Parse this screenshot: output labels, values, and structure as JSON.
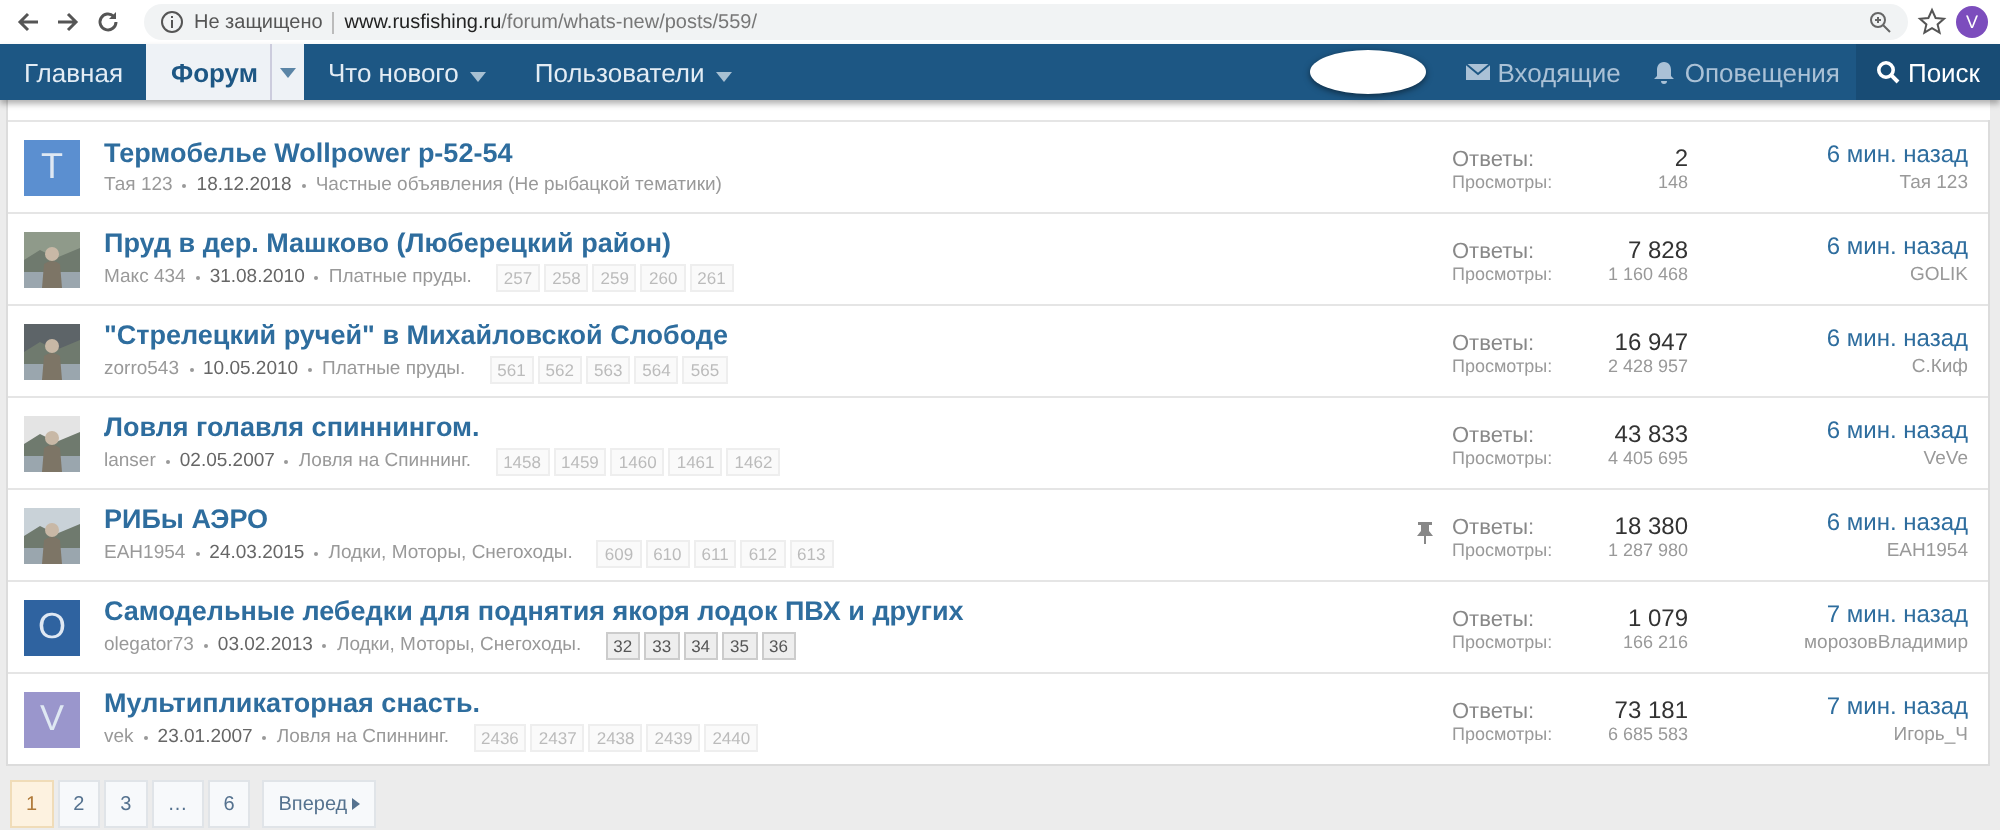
{
  "browser": {
    "security": "Не защищено",
    "url_domain": "www.rusfishing.ru",
    "url_path": "/forum/whats-new/posts/559/",
    "profile_letter": "V"
  },
  "nav": {
    "tabs": [
      {
        "label": "Главная",
        "selected": false,
        "has_menu": false
      },
      {
        "label": "Форум",
        "selected": true,
        "has_menu": true
      },
      {
        "label": "Что нового",
        "selected": false,
        "has_menu": true
      },
      {
        "label": "Пользователи",
        "selected": false,
        "has_menu": true
      }
    ],
    "right": [
      {
        "kind": "inbox",
        "label": "Входящие"
      },
      {
        "kind": "alerts",
        "label": "Оповещения"
      },
      {
        "kind": "search",
        "label": "Поиск"
      }
    ]
  },
  "threads": [
    {
      "avatar": {
        "kind": "letter",
        "letter": "T",
        "color": "#5b8fd0"
      },
      "title": "Термобелье Wollpower p-52-54",
      "author": "Тая 123",
      "date": "18.12.2018",
      "forum": "Частные объявления (Не рыбацкой тематики)",
      "pinned": false,
      "replies_label": "Ответы:",
      "replies": "2",
      "views_label": "Просмотры:",
      "views": "148",
      "last_time": "6 мин. назад",
      "last_user": "Тая 123"
    },
    {
      "title": "Пруд в дер. Машково (Люберецкий район)",
      "author": "Макс 434",
      "date": "31.08.2010",
      "forum": "Платные пруды.",
      "pages": [
        "257",
        "258",
        "259",
        "260",
        "261"
      ],
      "pages_emphasized": false,
      "pinned": false,
      "replies_label": "Ответы:",
      "replies": "7 828",
      "views_label": "Просмотры:",
      "views": "1 160 468",
      "last_time": "6 мин. назад",
      "last_user": "GOLIK"
    },
    {
      "title": "\"Стрелецкий ручей\" в Михайловской Слободе",
      "author": "zorro543",
      "date": "10.05.2010",
      "forum": "Платные пруды.",
      "pages": [
        "561",
        "562",
        "563",
        "564",
        "565"
      ],
      "pages_emphasized": false,
      "pinned": false,
      "replies_label": "Ответы:",
      "replies": "16 947",
      "views_label": "Просмотры:",
      "views": "2 428 957",
      "last_time": "6 мин. назад",
      "last_user": "С.Киф"
    },
    {
      "title": "Ловля голавля спиннингом.",
      "author": "lanser",
      "date": "02.05.2007",
      "forum": "Ловля на Спиннинг.",
      "pages": [
        "1458",
        "1459",
        "1460",
        "1461",
        "1462"
      ],
      "pages_emphasized": false,
      "pinned": false,
      "replies_label": "Ответы:",
      "replies": "43 833",
      "views_label": "Просмотры:",
      "views": "4 405 695",
      "last_time": "6 мин. назад",
      "last_user": "VeVe"
    },
    {
      "title": "РИБы АЭРО",
      "author": "EAH1954",
      "date": "24.03.2015",
      "forum": "Лодки, Моторы, Снегоходы.",
      "pages": [
        "609",
        "610",
        "611",
        "612",
        "613"
      ],
      "pages_emphasized": false,
      "pinned": true,
      "replies_label": "Ответы:",
      "replies": "18 380",
      "views_label": "Просмотры:",
      "views": "1 287 980",
      "last_time": "6 мин. назад",
      "last_user": "EAH1954"
    },
    {
      "avatar": {
        "kind": "letter",
        "letter": "O",
        "color": "#2f63a0"
      },
      "title": "Самодельные лебедки для поднятия якоря лодок ПВХ и других",
      "author": "olegator73",
      "date": "03.02.2013",
      "forum": "Лодки, Моторы, Снегоходы.",
      "pages": [
        "32",
        "33",
        "34",
        "35",
        "36"
      ],
      "pages_emphasized": true,
      "pinned": false,
      "replies_label": "Ответы:",
      "replies": "1 079",
      "views_label": "Просмотры:",
      "views": "166 216",
      "last_time": "7 мин. назад",
      "last_user": "морозовВладимир"
    },
    {
      "avatar": {
        "kind": "letter",
        "letter": "V",
        "color": "#9a96cc"
      },
      "title": "Мультипликаторная снасть.",
      "author": "vek",
      "date": "23.01.2007",
      "forum": "Ловля на Спиннинг.",
      "pages": [
        "2436",
        "2437",
        "2438",
        "2439",
        "2440"
      ],
      "pages_emphasized": false,
      "pinned": false,
      "replies_label": "Ответы:",
      "replies": "73 181",
      "views_label": "Просмотры:",
      "views": "6 685 583",
      "last_time": "7 мин. назад",
      "last_user": "Игорь_Ч"
    }
  ],
  "pagination": {
    "pages": [
      {
        "label": "1",
        "selected": true
      },
      {
        "label": "2",
        "selected": false
      },
      {
        "label": "3",
        "selected": false
      },
      {
        "label": "…",
        "selected": false
      },
      {
        "label": "6",
        "selected": false
      }
    ],
    "next": "Вперед"
  }
}
